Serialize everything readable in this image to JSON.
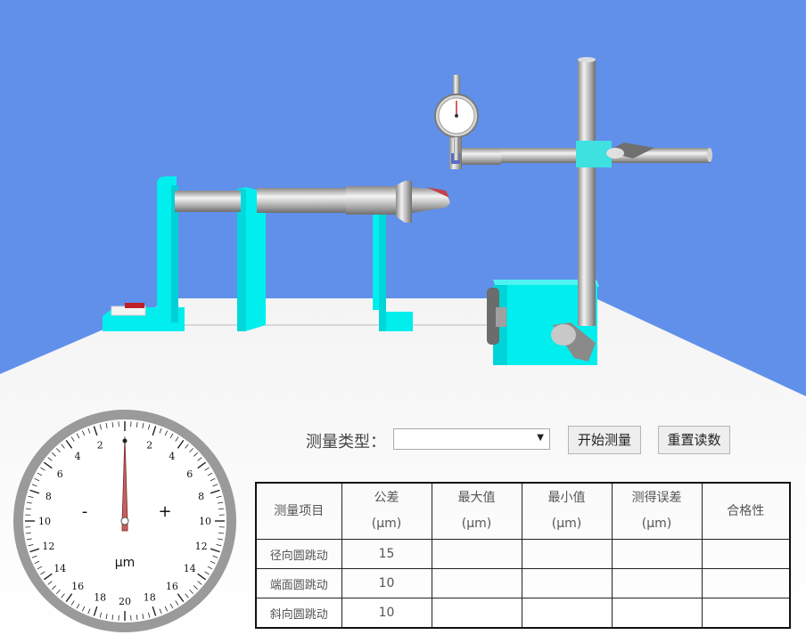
{
  "colors": {
    "sky": "#6190EA",
    "floor": "#ffffff",
    "cyan": "#00EEEE",
    "steel": "#c8c8c8",
    "dial_needle": "#c46060"
  },
  "controls": {
    "type_label": "测量类型：",
    "type_select_value": "",
    "start_button": "开始测量",
    "reset_button": "重置读数"
  },
  "gauge": {
    "unit": "μm",
    "minus": "-",
    "plus": "+",
    "reading": 0,
    "scale_labels": [
      "2",
      "4",
      "6",
      "8",
      "10",
      "12",
      "14",
      "16",
      "18",
      "20"
    ]
  },
  "table": {
    "headers": [
      {
        "line1": "测量项目",
        "line2": ""
      },
      {
        "line1": "公差",
        "line2": "(μm)"
      },
      {
        "line1": "最大值",
        "line2": "(μm)"
      },
      {
        "line1": "最小值",
        "line2": "(μm)"
      },
      {
        "line1": "测得误差",
        "line2": "(μm)"
      },
      {
        "line1": "合格性",
        "line2": ""
      }
    ],
    "rows": [
      {
        "item": "径向圆跳动",
        "tolerance": "15",
        "max": "",
        "min": "",
        "error": "",
        "pass": ""
      },
      {
        "item": "端面圆跳动",
        "tolerance": "10",
        "max": "",
        "min": "",
        "error": "",
        "pass": ""
      },
      {
        "item": "斜向圆跳动",
        "tolerance": "10",
        "max": "",
        "min": "",
        "error": "",
        "pass": ""
      }
    ]
  }
}
